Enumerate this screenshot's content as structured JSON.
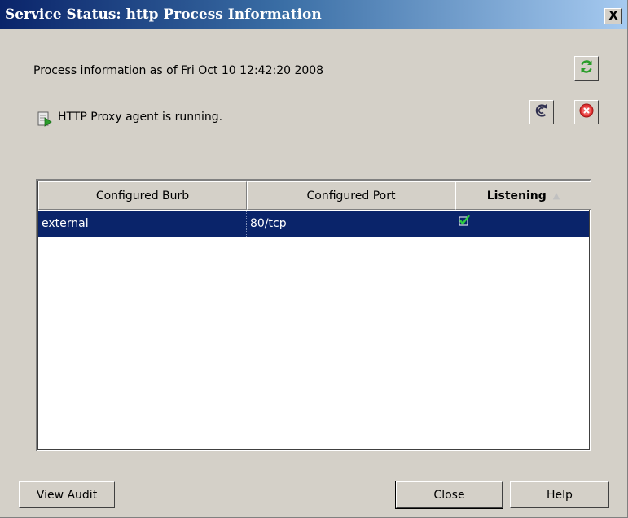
{
  "window": {
    "title": "Service Status: http Process Information",
    "close_label": "X"
  },
  "info": {
    "timestamp_line": "Process information as of Fri Oct 10 12:42:20 2008",
    "status_text": "HTTP Proxy agent is running."
  },
  "icons": {
    "refresh": "refresh-icon",
    "restart": "restart-icon",
    "stop": "stop-icon",
    "agent": "agent-status-icon",
    "listening_check": "check-icon"
  },
  "table": {
    "columns": [
      "Configured Burb",
      "Configured Port",
      "Listening"
    ],
    "sort_arrow": "▲",
    "rows": [
      {
        "burb": "external",
        "port": "80/tcp",
        "listening": true
      }
    ]
  },
  "buttons": {
    "view_audit": "View Audit",
    "close": "Close",
    "help": "Help"
  },
  "colors": {
    "selection": "#0a246a",
    "check": "#2ecc40",
    "stop": "#e03030",
    "refresh": "#2a9d2a"
  }
}
